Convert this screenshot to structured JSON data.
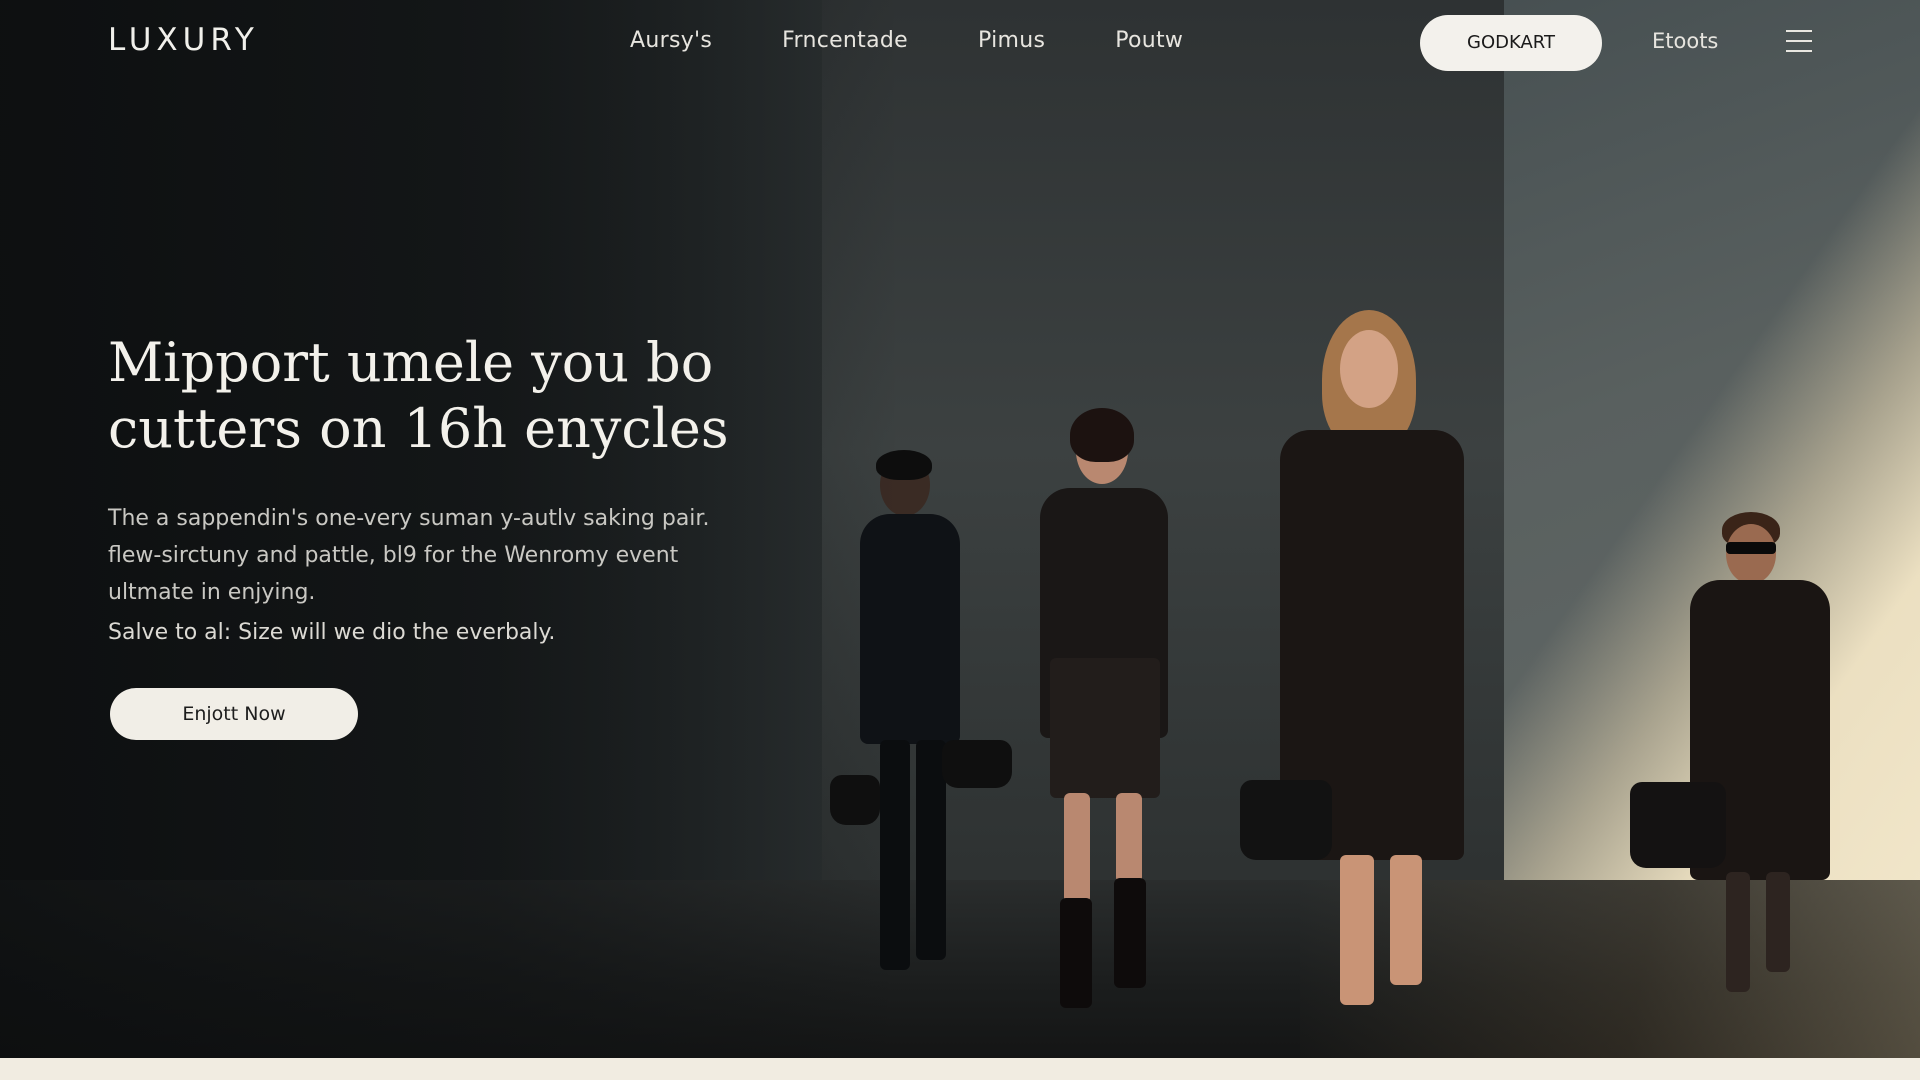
{
  "nav": {
    "logo": "LUXURY",
    "links": [
      "Aursy's",
      "Frncentade",
      "Pimus",
      "Poutw"
    ],
    "cta_label": "GODKART",
    "extra_label": "Etoots",
    "menu_icon": "hamburger-menu-icon"
  },
  "hero": {
    "headline": "Mipport umele you bo cutters on 16h enycles",
    "body": "The a sappendin's one-very suman y-autlv saking pair. flew-sirctuny and pattle, bl9 for the Wenromy event ultmate in enjying.",
    "sub": "Salve to al: Size will we dio the everbaly.",
    "button_label": "Enjott Now"
  },
  "colors": {
    "background": "#1a1c1d",
    "pill": "#f3f1ec",
    "text": "#f3f1eb",
    "sunlight": "#f2e7cb",
    "footer_strip": "#f1ece1"
  }
}
